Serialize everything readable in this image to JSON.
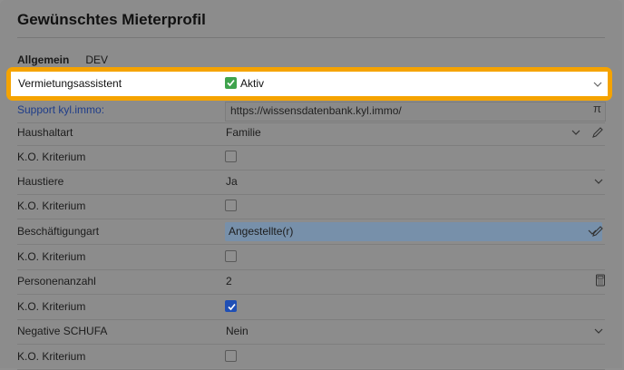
{
  "title": "Gewünschtes Mieterprofil",
  "tabs": [
    {
      "label": "Allgemein",
      "active": true
    },
    {
      "label": "DEV",
      "active": false
    }
  ],
  "highlighted_row": {
    "label": "Vermietungsassistent",
    "value": "Aktiv",
    "accent": "#f5a300"
  },
  "rows": [
    {
      "label": "Support kyl.immo:",
      "value": "https://wissensdatenbank.kyl.immo/",
      "kind": "link"
    },
    {
      "label": "Haushaltart",
      "value": "Familie",
      "kind": "select-edit"
    },
    {
      "label": "K.O. Kriterium",
      "checked": false,
      "kind": "checkbox"
    },
    {
      "label": "Haustiere",
      "value": "Ja",
      "kind": "select"
    },
    {
      "label": "K.O. Kriterium",
      "checked": false,
      "kind": "checkbox"
    },
    {
      "label": "Beschäftigungart",
      "value": "Angestellte(r)",
      "kind": "select-edit"
    },
    {
      "label": "K.O. Kriterium",
      "checked": false,
      "kind": "checkbox"
    },
    {
      "label": "Personenanzahl",
      "value": "2",
      "kind": "number"
    },
    {
      "label": "K.O. Kriterium",
      "checked": true,
      "kind": "checkbox"
    },
    {
      "label": "Negative SCHUFA",
      "value": "Nein",
      "kind": "select"
    },
    {
      "label": "K.O. Kriterium",
      "checked": false,
      "kind": "checkbox"
    }
  ],
  "colors": {
    "link": "#1f3d8a",
    "select_bg": "#7790aa",
    "checkbox_on": "#1f4fb5"
  }
}
